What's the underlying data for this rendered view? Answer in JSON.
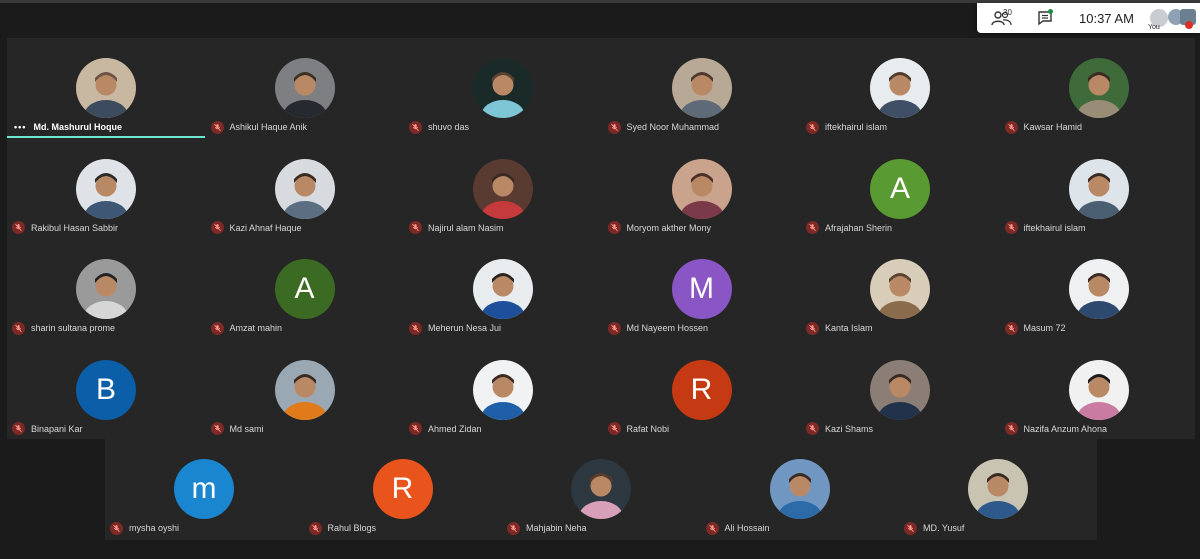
{
  "toolbar": {
    "participants_count": "30",
    "time": "10:37  AM",
    "you_label": "You",
    "icons": [
      "people-icon",
      "chat-icon",
      "self-view-icon"
    ]
  },
  "participants": [
    {
      "name": "Md. Mashurul Hoque",
      "avatar": "photo",
      "speaking": true,
      "muted": false
    },
    {
      "name": "Ashikul Haque Anik",
      "avatar": "photo",
      "muted": true
    },
    {
      "name": "shuvo das",
      "avatar": "photo",
      "muted": true
    },
    {
      "name": "Syed Noor Muhammad",
      "avatar": "photo",
      "muted": true
    },
    {
      "name": "iftekhairul islam",
      "avatar": "photo",
      "muted": true
    },
    {
      "name": "Kawsar Hamid",
      "avatar": "photo",
      "muted": true
    },
    {
      "name": "Rakibul Hasan Sabbir",
      "avatar": "photo",
      "muted": true
    },
    {
      "name": "Kazi Ahnaf Haque",
      "avatar": "photo",
      "muted": true
    },
    {
      "name": "Najirul alam Nasim",
      "avatar": "photo",
      "muted": true
    },
    {
      "name": "Moryom akther Mony",
      "avatar": "photo",
      "muted": true
    },
    {
      "name": "Afrajahan Sherin",
      "avatar": "letter",
      "letter": "A",
      "color": "#5a9a32",
      "muted": true
    },
    {
      "name": "iftekhairul islam",
      "avatar": "photo",
      "muted": true
    },
    {
      "name": "sharin sultana prome",
      "avatar": "photo",
      "muted": true
    },
    {
      "name": "Amzat mahin",
      "avatar": "letter",
      "letter": "A",
      "color": "#3b6b22",
      "muted": true
    },
    {
      "name": "Meherun Nesa Jui",
      "avatar": "photo",
      "muted": true
    },
    {
      "name": "Md Nayeem Hossen",
      "avatar": "letter",
      "letter": "M",
      "color": "#8a55c4",
      "muted": true
    },
    {
      "name": "Kanta Islam",
      "avatar": "photo",
      "muted": true
    },
    {
      "name": "Masum 72",
      "avatar": "photo",
      "muted": true
    },
    {
      "name": "Binapani Kar",
      "avatar": "letter",
      "letter": "B",
      "color": "#0b5ea8",
      "muted": true
    },
    {
      "name": "Md sami",
      "avatar": "photo",
      "muted": true
    },
    {
      "name": "Ahmed Zidan",
      "avatar": "photo",
      "muted": true
    },
    {
      "name": "Rafat Nobi",
      "avatar": "letter",
      "letter": "R",
      "color": "#c53a12",
      "muted": true
    },
    {
      "name": "Kazi Shams",
      "avatar": "photo",
      "muted": true
    },
    {
      "name": "Nazifa Anzum Ahona",
      "avatar": "photo",
      "muted": true
    },
    {
      "name": "mysha oyshi",
      "avatar": "letter",
      "letter": "m",
      "color": "#1a86d0",
      "muted": true
    },
    {
      "name": "Rahul Blogs",
      "avatar": "letter",
      "letter": "R",
      "color": "#e8541c",
      "muted": true
    },
    {
      "name": "Mahjabin Neha",
      "avatar": "photo",
      "muted": true
    },
    {
      "name": "Ali Hossain",
      "avatar": "photo",
      "muted": true
    },
    {
      "name": "MD. Yusuf",
      "avatar": "photo",
      "muted": true
    }
  ]
}
